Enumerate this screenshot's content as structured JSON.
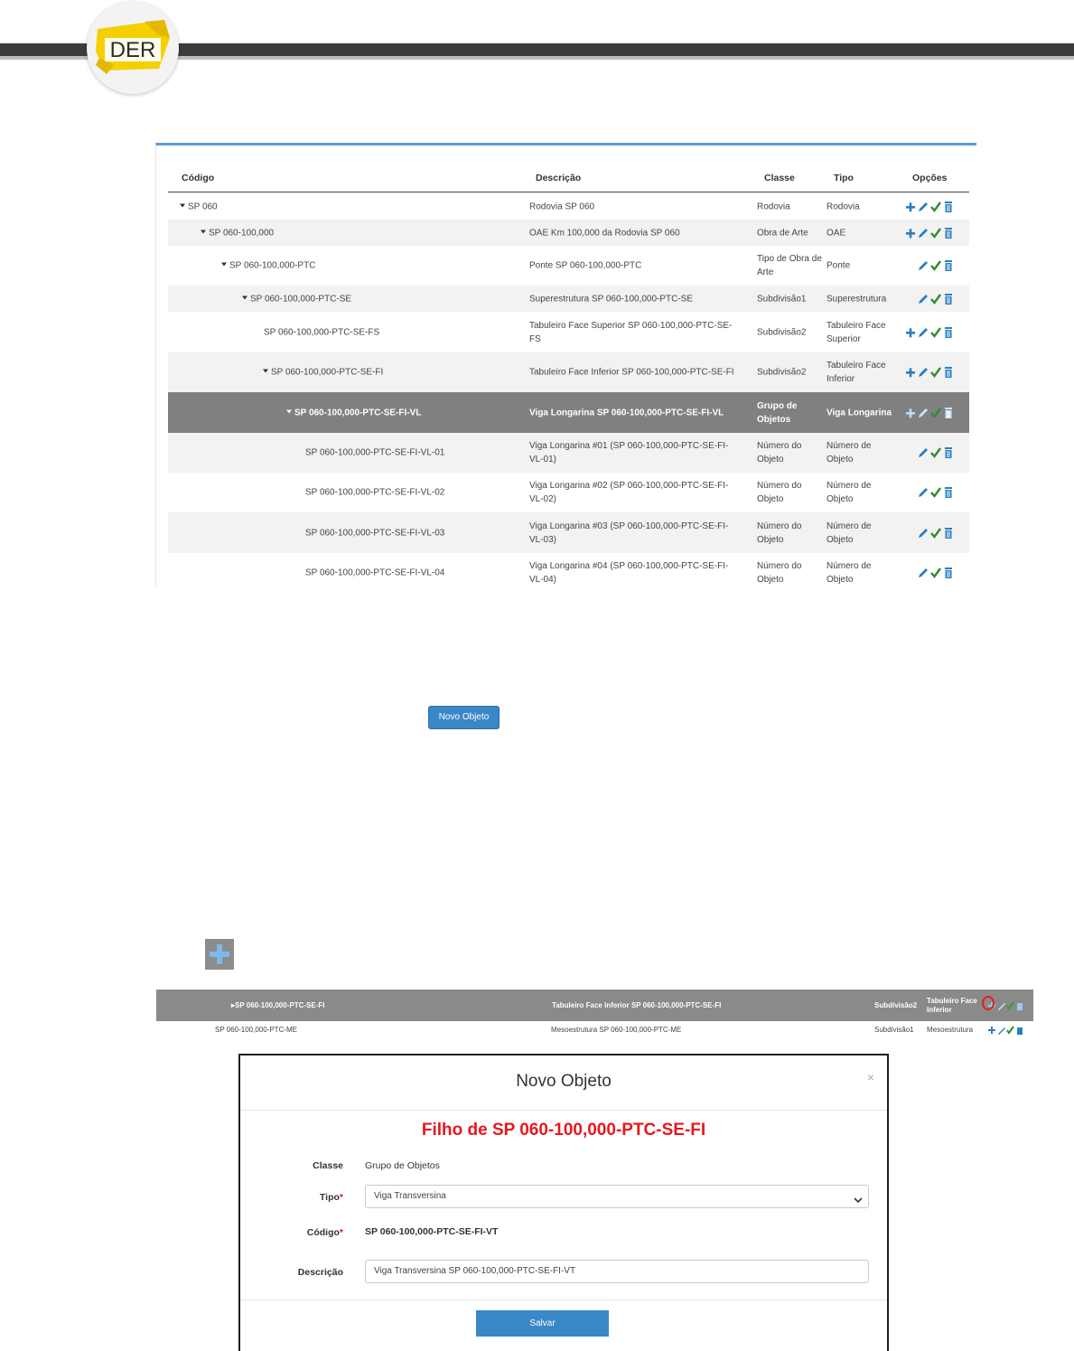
{
  "logo": {
    "text": "DER"
  },
  "tree": {
    "headers": {
      "codigo": "Código",
      "descricao": "Descrição",
      "classe": "Classe",
      "tipo": "Tipo",
      "opcoes": "Opções"
    },
    "rows": [
      {
        "code": "SP 060",
        "caret": true,
        "desc": "Rodovia SP 060",
        "cls": "Rodovia",
        "tipo": "Rodovia",
        "add": true
      },
      {
        "code": "SP 060-100,000",
        "caret": true,
        "desc": "OAE Km 100,000 da Rodovia SP 060",
        "cls": "Obra de Arte",
        "tipo": "OAE",
        "add": true
      },
      {
        "code": "SP 060-100,000-PTC",
        "caret": true,
        "desc": "Ponte SP 060-100,000-PTC",
        "cls": "Tipo de Obra de Arte",
        "tipo": "Ponte",
        "add": false
      },
      {
        "code": "SP 060-100,000-PTC-SE",
        "caret": true,
        "desc": "Superestrutura SP 060-100,000-PTC-SE",
        "cls": "Subdivisão1",
        "tipo": "Superestrutura",
        "add": false
      },
      {
        "code": "SP 060-100,000-PTC-SE-FS",
        "caret": false,
        "desc": "Tabuleiro Face Superior SP 060-100,000-PTC-SE-FS",
        "cls": "Subdivisão2",
        "tipo": "Tabuleiro Face Superior",
        "add": true
      },
      {
        "code": "SP 060-100,000-PTC-SE-FI",
        "caret": true,
        "desc": "Tabuleiro Face Inferior SP 060-100,000-PTC-SE-FI",
        "cls": "Subdivisão2",
        "tipo": "Tabuleiro Face Inferior",
        "add": true
      },
      {
        "code": "SP 060-100,000-PTC-SE-FI-VL",
        "caret": true,
        "desc": "Viga Longarina SP 060-100,000-PTC-SE-FI-VL",
        "cls": "Grupo de Objetos",
        "tipo": "Viga Longarina",
        "add": true,
        "selected": true
      },
      {
        "code": "SP 060-100,000-PTC-SE-FI-VL-01",
        "caret": false,
        "desc": "Viga Longarina #01 (SP 060-100,000-PTC-SE-FI-VL-01)",
        "cls": "Número do Objeto",
        "tipo": "Número de Objeto",
        "add": false
      },
      {
        "code": "SP 060-100,000-PTC-SE-FI-VL-02",
        "caret": false,
        "desc": "Viga Longarina #02 (SP 060-100,000-PTC-SE-FI-VL-02)",
        "cls": "Número do Objeto",
        "tipo": "Número de Objeto",
        "add": false
      },
      {
        "code": "SP 060-100,000-PTC-SE-FI-VL-03",
        "caret": false,
        "desc": "Viga Longarina #03 (SP 060-100,000-PTC-SE-FI-VL-03)",
        "cls": "Número do Objeto",
        "tipo": "Número de Objeto",
        "add": false
      },
      {
        "code": "SP 060-100,000-PTC-SE-FI-VL-04",
        "caret": false,
        "desc": "Viga Longarina #04 (SP 060-100,000-PTC-SE-FI-VL-04)",
        "cls": "Número do Objeto",
        "tipo": "Número de Objeto",
        "add": false
      }
    ]
  },
  "novo_objeto_button": "Novo Objeto",
  "strip": {
    "row1": {
      "code": "SP 060-100,000-PTC-SE-FI",
      "desc": "Tabuleiro Face Inferior SP 060-100,000-PTC-SE-FI",
      "cls": "Subdivisão2",
      "tipo": "Tabuleiro Face Inferior"
    },
    "row2": {
      "code": "SP 060-100,000-PTC-ME",
      "desc": "Mesoestrutura SP 060-100,000-PTC-ME",
      "cls": "Subdivisão1",
      "tipo": "Mesoestrutura"
    }
  },
  "modal": {
    "title": "Novo Objeto",
    "close": "×",
    "subtitle": "Filho de SP 060-100,000-PTC-SE-FI",
    "classe_label": "Classe",
    "classe_value": "Grupo de Objetos",
    "tipo_label": "Tipo",
    "tipo_value": "Viga Transversina",
    "codigo_label": "Código",
    "codigo_value": "SP 060-100,000-PTC-SE-FI-VT",
    "descricao_label": "Descrição",
    "descricao_value": "Viga Transversina SP 060-100,000-PTC-SE-FI-VT",
    "required_mark": "*",
    "salvar": "Salvar"
  },
  "colors": {
    "accent": "#3a87c8",
    "icon_blue": "#2a7fc0",
    "check_green": "#2e8b2e",
    "required_red": "#e8171b",
    "selected_row": "#808080"
  }
}
